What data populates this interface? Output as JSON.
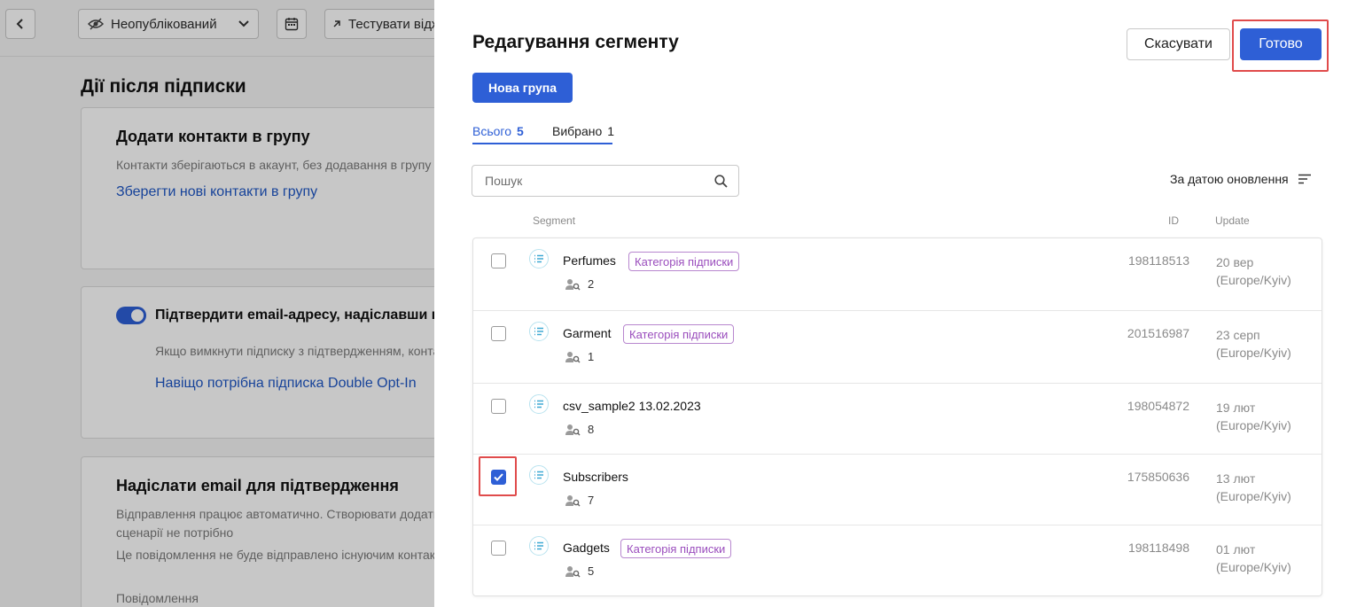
{
  "background": {
    "topbar": {
      "status_label": "Неопублікований",
      "test_label": "Тестувати віджет"
    },
    "heading": "Дії після підписки",
    "card1": {
      "title": "Додати контакти в групу",
      "desc": "Контакти зберігаються в акаунт, без додавання в групу",
      "link": "Зберегти нові контакти в групу"
    },
    "card2": {
      "title": "Підтвердити email-адресу, надіславши повідомлення",
      "desc": "Якщо вимкнути підписку з підтвердженням, контакти",
      "link": "Навіщо потрібна підписка Double Opt-In"
    },
    "card3": {
      "title": "Надіслати email для підтвердження",
      "desc1": "Відправлення працює автоматично. Створювати додатковий",
      "desc2": "сценарії не потрібно",
      "desc3": "Це повідомлення не буде відправлено існуючим контактам",
      "label": "Повідомлення"
    }
  },
  "drawer": {
    "title": "Редагування сегменту",
    "cancel_label": "Скасувати",
    "done_label": "Готово",
    "new_group_label": "Нова група",
    "tabs": {
      "all_label": "Всього",
      "all_count": "5",
      "selected_label": "Вибрано",
      "selected_count": "1"
    },
    "search_placeholder": "Пошук",
    "sort_label": "За датою оновлення",
    "columns": {
      "segment": "Segment",
      "id": "ID",
      "update": "Update"
    },
    "rows": [
      {
        "name": "Perfumes",
        "badge": "Категорія підписки",
        "members": "2",
        "id": "198118513",
        "date": "20 вер",
        "tz": "(Europe/Kyiv)",
        "checked": false
      },
      {
        "name": "Garment",
        "badge": "Категорія підписки",
        "members": "1",
        "id": "201516987",
        "date": "23 серп",
        "tz": "(Europe/Kyiv)",
        "checked": false
      },
      {
        "name": "csv_sample2 13.02.2023",
        "badge": "",
        "members": "8",
        "id": "198054872",
        "date": "19 лют",
        "tz": "(Europe/Kyiv)",
        "checked": false
      },
      {
        "name": "Subscribers",
        "badge": "",
        "members": "7",
        "id": "175850636",
        "date": "13 лют",
        "tz": "(Europe/Kyiv)",
        "checked": true
      },
      {
        "name": "Gadgets",
        "badge": "Категорія підписки",
        "members": "5",
        "id": "198118498",
        "date": "01 лют",
        "tz": "(Europe/Kyiv)",
        "checked": false
      }
    ]
  },
  "colors": {
    "accent": "#2e5fd6",
    "badge": "#9a4dbd",
    "highlight": "#e04b4b"
  }
}
